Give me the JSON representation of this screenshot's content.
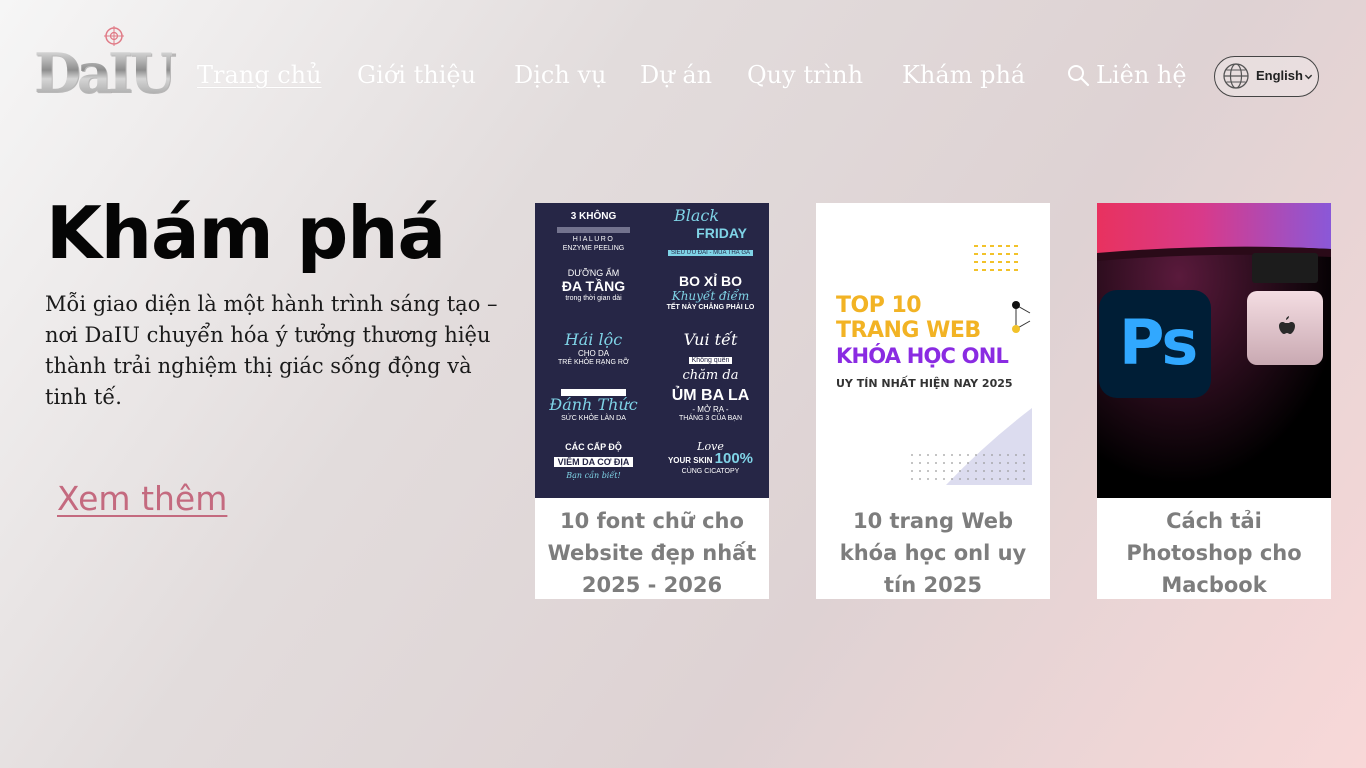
{
  "brand": {
    "logo_text": "DaIU"
  },
  "nav": {
    "items": [
      {
        "label": "Trang chủ",
        "active": true
      },
      {
        "label": "Giới thiệu",
        "active": false
      },
      {
        "label": "Dịch vụ",
        "active": false
      },
      {
        "label": "Dự án",
        "active": false
      },
      {
        "label": "Quy trình",
        "active": false
      },
      {
        "label": "Khám phá",
        "active": false
      },
      {
        "label": "Liên hệ",
        "active": false
      }
    ],
    "search_icon": "search-icon",
    "language": {
      "label": "English",
      "icon": "globe-icon"
    }
  },
  "hero": {
    "title": "Khám phá",
    "description": "Mỗi giao diện là một hành trình sáng tạo – nơi DaIU chuyển hóa ý tưởng thương hiệu thành trải nghiệm thị giác sống động và tinh tế.",
    "cta_label": "Xem thêm"
  },
  "cards": [
    {
      "caption": "10 font chữ cho Website đẹp nhất 2025 - 2026",
      "image_texts": {
        "a1": "3 KHÔNG",
        "a2": "HIALURO",
        "a3": "ENZYME PEELING",
        "b1": "Black",
        "b2": "FRIDAY",
        "b3": "SIÊU ƯU ĐÃI - MUA THẢ GA",
        "c1": "DƯỠNG ẨM",
        "c2": "ĐA TẦNG",
        "c3": "trong thời gian dài",
        "d1": "BO XỈ BO",
        "d2": "Khuyết điểm",
        "d3": "TẾT NÀY CHẲNG PHẢI LO",
        "e1": "Hái lộc",
        "e2": "CHO DA",
        "e3": "TRẺ KHỎE RẠNG RỠ",
        "f1": "Vui tết",
        "f2": "Không quên",
        "f3": "chăm da",
        "g1": "Đánh Thức",
        "g2": "SỨC KHỎE LÀN DA",
        "h1": "ỦM BA LA",
        "h2": "- MỞ RA -",
        "h3": "THÁNG 3 CỦA BẠN",
        "i1": "CÁC CẤP ĐỘ",
        "i2": "VIÊM DA CƠ ĐỊA",
        "i3": "Bạn cần biết!",
        "j1": "Love",
        "j2": "YOUR SKIN",
        "j3": "100%",
        "j4": "CÙNG CICATOPY"
      }
    },
    {
      "caption": "10 trang Web khóa học onl uy tín 2025",
      "image_texts": {
        "l1": "TOP 10",
        "l2": "TRANG WEB",
        "l3": "KHÓA HỌC ONL",
        "l4": "UY TÍN NHẤT HIỆN NAY 2025"
      }
    },
    {
      "caption": "Cách tải Photoshop cho Macbook",
      "image_texts": {
        "ps": "Ps"
      }
    }
  ],
  "colors": {
    "accent_link": "#c46a7f",
    "caption_gray": "#7d7d7d",
    "nav_text": "#ffffff",
    "photoshop_blue": "#31a8ff",
    "photoshop_bg": "#001e36"
  }
}
